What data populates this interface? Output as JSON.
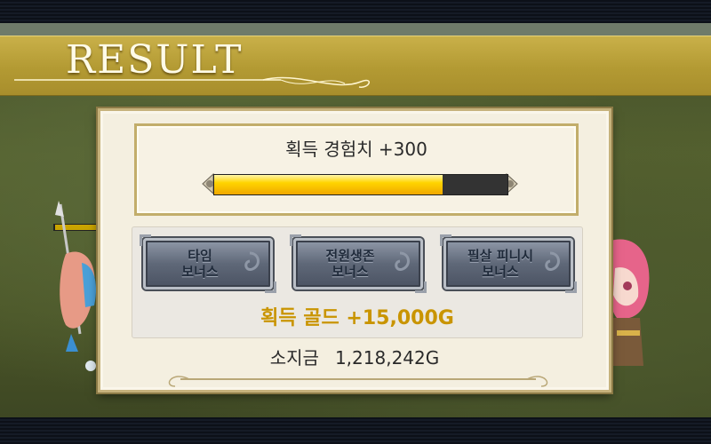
{
  "banner": {
    "title": "RESULT"
  },
  "exp": {
    "label": "획득 경험치 +300",
    "progress": 0.78
  },
  "bonus": {
    "buttons": [
      {
        "label": "타임\n보너스"
      },
      {
        "label": "전원생존\n보너스"
      },
      {
        "label": "필살 피니시\n보너스"
      }
    ],
    "gold_label": "획득 골드 +15,000G"
  },
  "owned": {
    "label": "소지금",
    "value": "1,218,242G"
  },
  "colors": {
    "banner": "#b39a33",
    "gold": "#c99400",
    "exp_fill": "#ffd400",
    "panel": "#f4efe0"
  }
}
